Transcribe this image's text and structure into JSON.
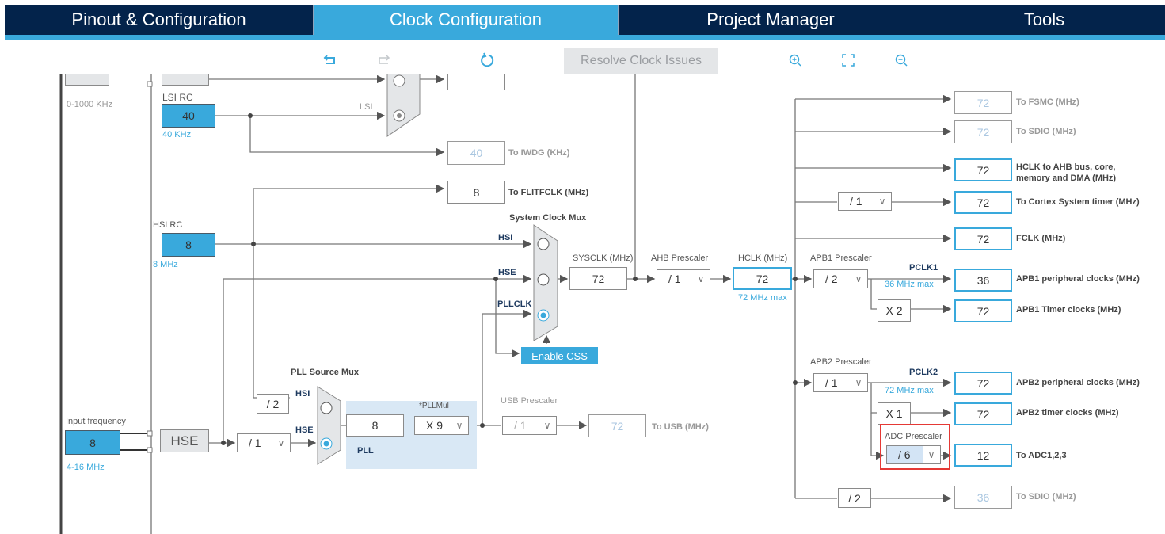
{
  "tabs": [
    {
      "label": "Pinout & Configuration",
      "active": false
    },
    {
      "label": "Clock Configuration",
      "active": true
    },
    {
      "label": "Project Manager",
      "active": false
    },
    {
      "label": "Tools",
      "active": false
    }
  ],
  "toolbar": {
    "undo": "undo-icon",
    "redo": "redo-icon",
    "reset": "reset-icon",
    "resolve_label": "Resolve Clock Issues",
    "zoom_in": "zoom-in-icon",
    "fit": "fit-icon",
    "zoom_out": "zoom-out-icon"
  },
  "diagram": {
    "lse_range": "0-1000 KHz",
    "lsi": {
      "title": "LSI RC",
      "value": "40",
      "freq": "40 KHz",
      "mux_label": "LSI"
    },
    "iwdg": {
      "value": "40",
      "label": "To IWDG (KHz)"
    },
    "flitf": {
      "value": "8",
      "label": "To FLITFCLK (MHz)"
    },
    "hsi": {
      "title": "HSI RC",
      "value": "8",
      "freq": "8 MHz"
    },
    "sysmux": {
      "title": "System Clock Mux",
      "in1": "HSI",
      "in2": "HSE",
      "in3": "PLLCLK"
    },
    "enable_css": "Enable CSS",
    "sysclk": {
      "label": "SYSCLK (MHz)",
      "value": "72"
    },
    "ahb": {
      "label": "AHB Prescaler",
      "value": "/ 1"
    },
    "hclk": {
      "label": "HCLK (MHz)",
      "value": "72",
      "max": "72 MHz max"
    },
    "input": {
      "label": "Input frequency",
      "value": "8",
      "range": "4-16 MHz"
    },
    "hse_label": "HSE",
    "hse_div": "/ 1",
    "pllmux": {
      "title": "PLL Source Mux",
      "in1": "HSI",
      "in2": "HSE",
      "hsi_div": "/ 2"
    },
    "pll": {
      "value": "8",
      "label": "PLL",
      "mul_label": "*PLLMul",
      "mul": "X 9"
    },
    "usb": {
      "label": "USB Prescaler",
      "value": "/ 1",
      "out": "72",
      "out_label": "To USB (MHz)"
    },
    "outputs": [
      {
        "value": "72",
        "label": "To FSMC (MHz)",
        "enabled": false
      },
      {
        "value": "72",
        "label": "To SDIO (MHz)",
        "enabled": false
      },
      {
        "value": "72",
        "label": "HCLK to AHB bus, core, memory and DMA (MHz)",
        "enabled": true
      },
      {
        "value": "72",
        "label": "To Cortex System timer (MHz)",
        "enabled": true
      },
      {
        "value": "72",
        "label": "FCLK (MHz)",
        "enabled": true
      }
    ],
    "cortex_div": "/ 1",
    "apb1": {
      "label": "APB1 Prescaler",
      "value": "/ 2",
      "pclk": "PCLK1",
      "max": "36 MHz max",
      "periph": "36",
      "periph_label": "APB1 peripheral clocks (MHz)",
      "timer_mul": "X 2",
      "timer": "72",
      "timer_label": "APB1 Timer clocks (MHz)"
    },
    "apb2": {
      "label": "APB2 Prescaler",
      "value": "/ 1",
      "pclk": "PCLK2",
      "max": "72 MHz max",
      "periph": "72",
      "periph_label": "APB2 peripheral clocks (MHz)",
      "timer_mul": "X 1",
      "timer": "72",
      "timer_label": "APB2 timer clocks (MHz)"
    },
    "adc": {
      "label": "ADC Prescaler",
      "value": "/ 6",
      "out": "12",
      "out_label": "To ADC1,2,3"
    },
    "sdio2": {
      "div": "/ 2",
      "value": "36",
      "label": "To SDIO (MHz)"
    }
  }
}
